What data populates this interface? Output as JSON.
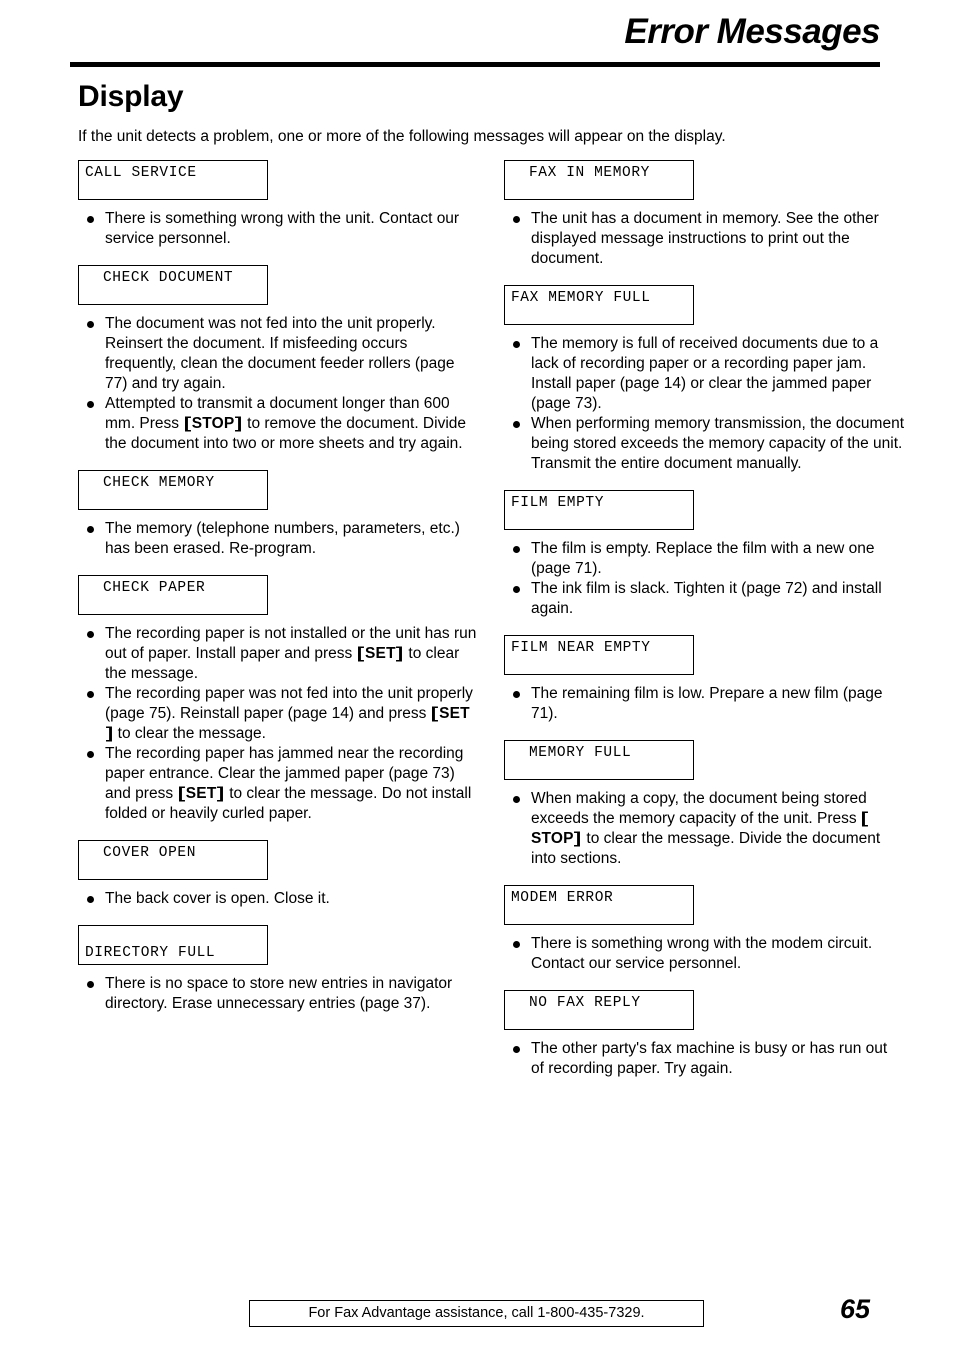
{
  "header": {
    "title": "Error Messages"
  },
  "section": {
    "heading": "Display",
    "intro": "If the unit detects a problem, one or more of the following messages will appear on the display."
  },
  "left_column": [
    {
      "display": "CALL SERVICE",
      "notes": [
        "There is something wrong with the unit. Contact our service personnel."
      ]
    },
    {
      "display": "CHECK DOCUMENT",
      "notes": [
        "The document was not fed into the unit properly. Reinsert the document. If misfeeding occurs frequently, clean the document feeder rollers (page 77) and try again."
      ],
      "notes_rich": [
        null,
        {
          "before": "Attempted to transmit a document longer than 600 mm. Press ",
          "key": "STOP",
          "after": " to remove the document. Divide the document into two or more sheets and try again."
        }
      ]
    },
    {
      "display": "CHECK MEMORY",
      "notes": [
        "The memory (telephone numbers, parameters, etc.) has been erased. Re-program."
      ]
    },
    {
      "display": "CHECK PAPER",
      "notes_rich": [
        {
          "before": "The recording paper is not installed or the unit has run out of paper. Install paper and press ",
          "key": "SET",
          "after": " to clear the message."
        },
        {
          "before": "The recording paper was not fed into the unit properly (page 75). Reinstall paper (page 14) and press ",
          "key": "SET",
          "after": " to clear the message."
        },
        {
          "before": "The recording paper has jammed near the recording paper entrance. Clear the jammed paper (page 73) and press ",
          "key": "SET",
          "after": " to clear the message. Do not install folded or heavily curled paper."
        }
      ]
    },
    {
      "display": "COVER OPEN",
      "notes": [
        "The back cover is open. Close it."
      ]
    },
    {
      "display": "DIRECTORY FULL",
      "notes": [
        "There is no space to store new entries in navigator directory. Erase unnecessary entries (page 37)."
      ]
    }
  ],
  "right_column": [
    {
      "display": "FAX IN MEMORY",
      "notes": [
        "The unit has a document in memory. See the other displayed message instructions to print out the document."
      ]
    },
    {
      "display": "FAX MEMORY FULL",
      "notes": [
        "The memory is full of received documents due to a lack of recording paper or a recording paper jam. Install paper (page 14) or clear the jammed paper (page 73).",
        "When performing memory transmission, the document being stored exceeds the memory capacity of the unit. Transmit the entire document manually."
      ]
    },
    {
      "display": "FILM EMPTY",
      "notes": [
        "The film is empty. Replace the film with a new one (page 71).",
        "The ink film is slack. Tighten it (page 72) and install again."
      ]
    },
    {
      "display": "FILM NEAR EMPTY",
      "notes": [
        "The remaining film is low. Prepare a new film (page 71)."
      ]
    },
    {
      "display": "MEMORY FULL",
      "notes_rich": [
        {
          "before": "When making a copy, the document being stored exceeds the memory capacity of the unit. Press ",
          "key": "STOP",
          "after": " to clear the message. Divide the document into sections."
        }
      ]
    },
    {
      "display": "MODEM ERROR",
      "notes": [
        "There is something wrong with the modem circuit. Contact our service personnel."
      ]
    },
    {
      "display": "NO FAX REPLY",
      "notes": [
        "The other party's fax machine is busy or has run out of recording paper. Try again."
      ]
    }
  ],
  "box_layout": {
    "CALL SERVICE": {
      "indent": false,
      "lower": false
    },
    "CHECK DOCUMENT": {
      "indent": true,
      "lower": false
    },
    "CHECK MEMORY": {
      "indent": true,
      "lower": false
    },
    "CHECK PAPER": {
      "indent": true,
      "lower": false
    },
    "COVER OPEN": {
      "indent": true,
      "lower": false
    },
    "DIRECTORY FULL": {
      "indent": false,
      "lower": true
    },
    "FAX IN MEMORY": {
      "indent": true,
      "lower": false
    },
    "FAX MEMORY FULL": {
      "indent": false,
      "lower": false
    },
    "FILM EMPTY": {
      "indent": false,
      "lower": false
    },
    "FILM NEAR EMPTY": {
      "indent": false,
      "lower": false
    },
    "MEMORY FULL": {
      "indent": true,
      "lower": false
    },
    "MODEM ERROR": {
      "indent": false,
      "lower": false
    },
    "NO FAX REPLY": {
      "indent": true,
      "lower": false
    }
  },
  "footer": {
    "assistance_text": "For Fax Advantage assistance, call 1-800-435-7329.",
    "page_number": "65"
  }
}
